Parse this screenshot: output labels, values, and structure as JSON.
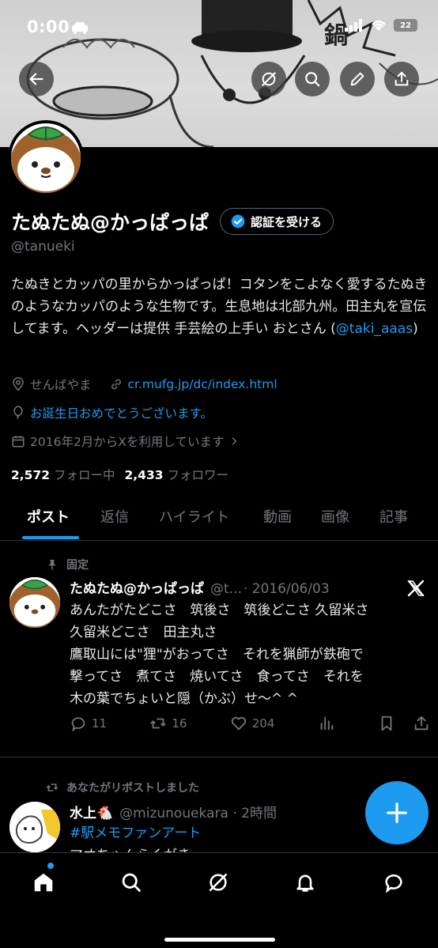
{
  "status_bar": {
    "time": "0:00",
    "battery": "22"
  },
  "header": {
    "buttons": [
      "back",
      "grok",
      "search",
      "edit",
      "share"
    ]
  },
  "profile": {
    "display_name": "たぬたぬ@かっぱっぱ",
    "verify_label": "認証を受ける",
    "handle": "@tanueki",
    "bio_text": "たぬきとカッパの里からかっぱっぱ！コタンをこよなく愛するたぬきのようなカッパのような生物です。生息地は北部九州。田主丸を宣伝してます。ヘッダーは提供 手芸絵の上手い おとさん (",
    "bio_link": "@taki_aaas",
    "bio_end": ")",
    "location": "せんばやま",
    "website": "cr.mufg.jp/dc/index.html",
    "birthday": "お誕生日おめでとうございます。",
    "joined": "2016年2月からXを利用しています",
    "following_count": "2,572",
    "following_label": "フォロー中",
    "followers_count": "2,433",
    "followers_label": "フォロワー"
  },
  "tabs": [
    "ポスト",
    "返信",
    "ハイライト",
    "動画",
    "画像",
    "記事"
  ],
  "posts": [
    {
      "context_label": "固定",
      "name": "たぬたぬ@かっぱっぱ",
      "handle_time": "@t...",
      "date": "· 2016/06/03",
      "lines": [
        "あんたがたどこさ　筑後さ　筑後どこさ 久留米さ",
        "久留米どこさ　田主丸さ",
        "鷹取山には\"狸\"がおってさ　それを猟師が鉄砲で",
        "撃ってさ　煮てさ　焼いてさ　食ってさ　それを",
        "木の葉でちょいと隠（かぶ）せ〜^ ^"
      ],
      "replies": "11",
      "reposts": "16",
      "likes": "204"
    },
    {
      "context_label": "あなたがリポストしました",
      "name": "水上🐔",
      "handle_time": "@mizunouekara · 2時間",
      "lines": [
        "#駅メモファンアート",
        "マオちゃんらくがき"
      ]
    }
  ],
  "colors": {
    "accent": "#1d9bf0",
    "background": "#000000",
    "secondary_text": "#71767b"
  }
}
